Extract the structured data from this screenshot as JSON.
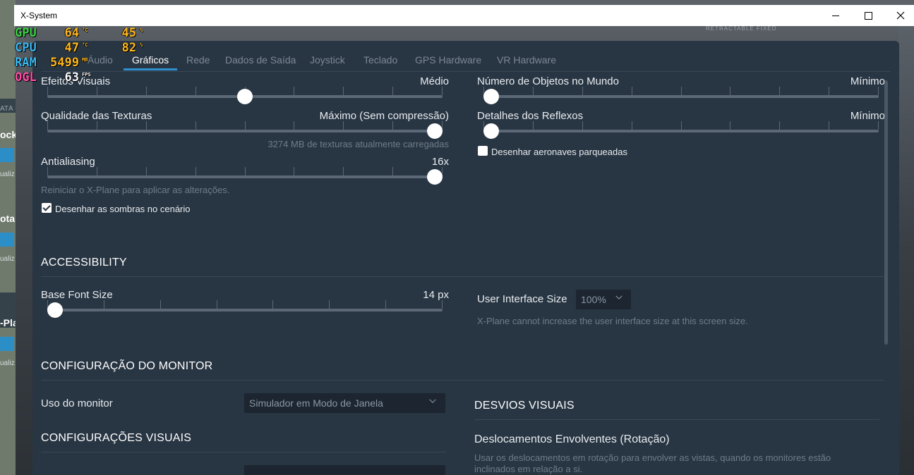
{
  "window": {
    "title": "X-System"
  },
  "background": {
    "left_labels": [
      "ATÁ N",
      "ock",
      "ualiz",
      "ota",
      "ualiz",
      "-Pla",
      "ualiz"
    ],
    "deco_text": "RETRACTABLE     FIXED"
  },
  "osd": {
    "rows": [
      {
        "key": "GPU",
        "key_color": "#3fd14a",
        "value": "64",
        "unit": "°C",
        "value2": "45",
        "unit2": "%"
      },
      {
        "key": "CPU",
        "key_color": "#3cb8f0",
        "value": "47",
        "unit": "°C",
        "value2": "82",
        "unit2": "%"
      },
      {
        "key": "RAM",
        "key_color": "#3cb8f0",
        "value": "5499",
        "unit": "MB",
        "value2": "",
        "unit2": ""
      },
      {
        "key": "OGL",
        "key_color": "#ff4fa6",
        "value": "63",
        "unit": "FPS",
        "value2": "",
        "unit2": ""
      }
    ]
  },
  "tabs": [
    {
      "label": "Áudio",
      "active": false
    },
    {
      "label": "Gráficos",
      "active": true
    },
    {
      "label": "Rede",
      "active": false
    },
    {
      "label": "Dados de Saída",
      "active": false
    },
    {
      "label": "Joystick",
      "active": false
    },
    {
      "label": "Teclado",
      "active": false
    },
    {
      "label": "GPS Hardware",
      "active": false
    },
    {
      "label": "VR Hardware",
      "active": false
    }
  ],
  "graphics": {
    "visual_effects": {
      "label": "Efeitos Visuais",
      "value": "Médio",
      "level": 0.5
    },
    "texture_quality": {
      "label": "Qualidade das Texturas",
      "value": "Máximo (Sem compressão)",
      "level": 1.0,
      "note": "3274 MB de texturas atualmente carregadas"
    },
    "antialiasing": {
      "label": "Antialiasing",
      "value": "16x",
      "level": 1.0,
      "note": "Reiniciar o X-Plane para aplicar as alterações."
    },
    "shadows": {
      "label": "Desenhar as sombras no cenário",
      "checked": true
    },
    "world_objects": {
      "label": "Número de Objetos no Mundo",
      "value": "Mínimo",
      "level": 0.0
    },
    "reflections": {
      "label": "Detalhes dos Reflexos",
      "value": "Mínimo",
      "level": 0.0
    },
    "parked_aircraft": {
      "label": "Desenhar aeronaves parqueadas",
      "checked": false
    }
  },
  "accessibility": {
    "heading": "ACCESSIBILITY",
    "base_font": {
      "label": "Base Font Size",
      "value": "14 px",
      "level": 0.0
    },
    "ui_size": {
      "label": "User Interface Size",
      "value": "100%",
      "note": "X-Plane cannot increase the user interface size at this screen size."
    }
  },
  "monitor": {
    "heading": "CONFIGURAÇÃO DO MONITOR",
    "usage_label": "Uso do monitor",
    "usage_value": "Simulador em Modo de Janela",
    "visual_heading": "CONFIGURAÇÕES VISUAIS",
    "offsets_heading": "DESVIOS VISUAIS",
    "wrap_title": "Deslocamentos Envolventes (Rotação)",
    "wrap_desc_1": "Usar os deslocamentos em rotação para envolver as vistas, quando os monitores estão",
    "wrap_desc_2": "inclinados em relação a si."
  }
}
